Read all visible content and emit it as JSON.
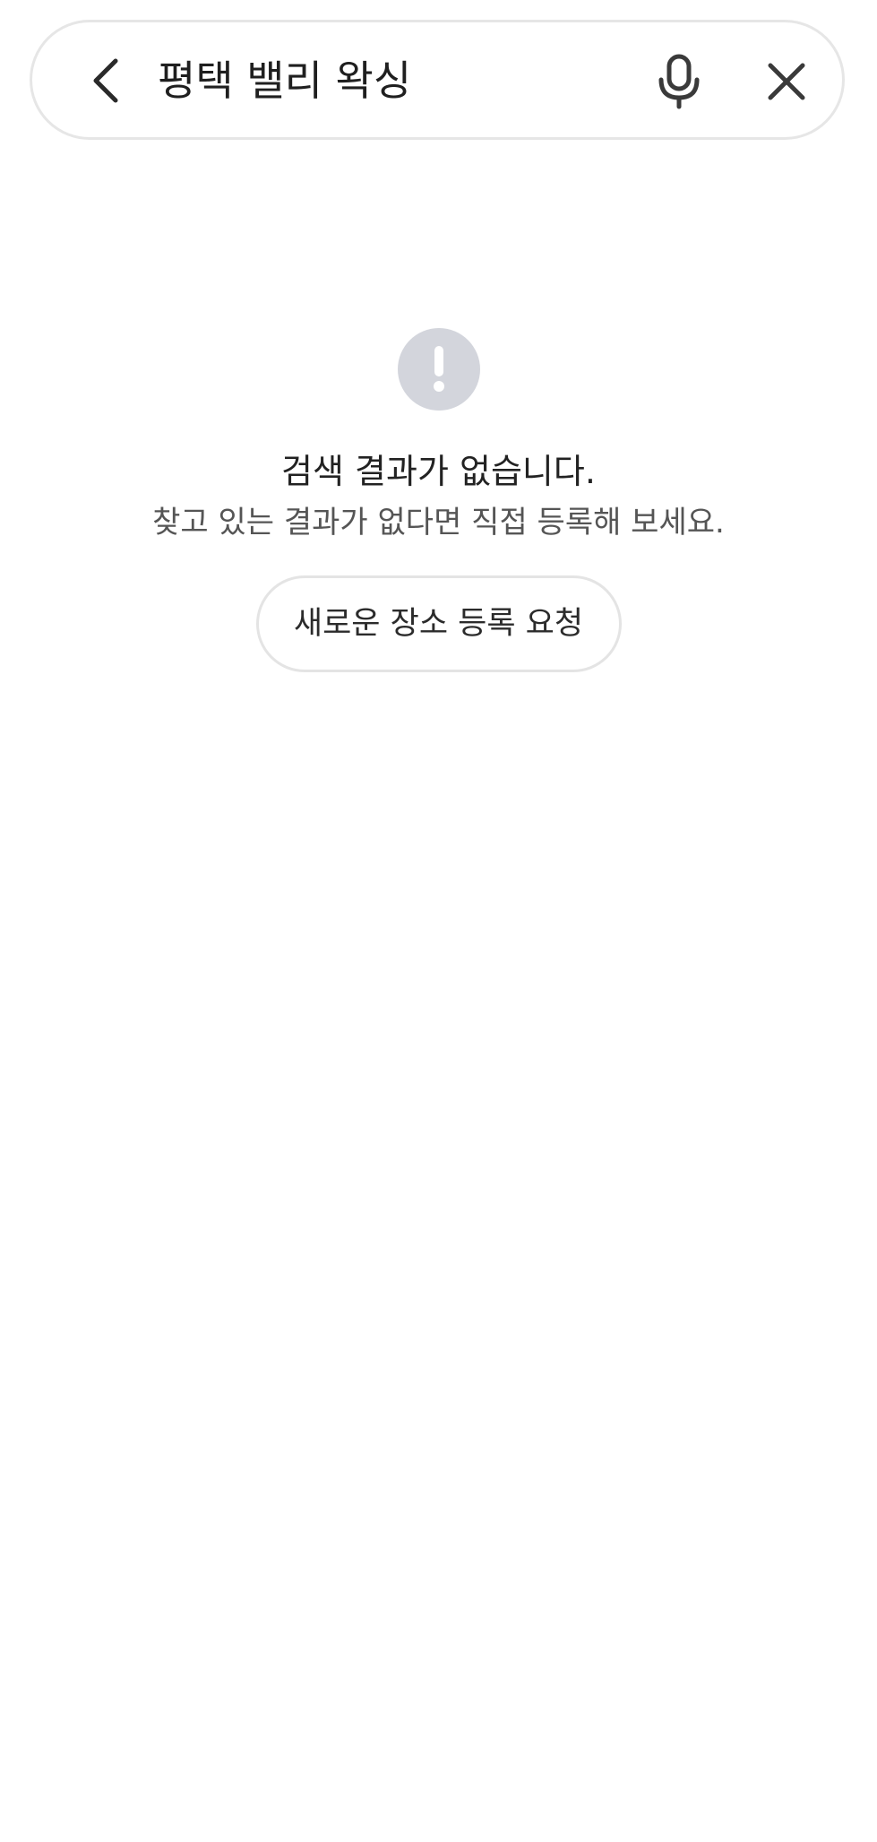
{
  "search": {
    "query": "평택 밸리 왁싱",
    "back_icon": "chevron-left-icon",
    "mic_icon": "microphone-icon",
    "clear_icon": "close-icon"
  },
  "empty_state": {
    "icon": "exclamation-icon",
    "title": "검색 결과가 없습니다.",
    "subtitle": "찾고 있는 결과가 없다면 직접 등록해 보세요.",
    "button_label": "새로운 장소 등록 요청"
  },
  "colors": {
    "icon_bg": "#d3d5dc",
    "border": "#e6e6e6",
    "text": "#1f1f1f"
  }
}
